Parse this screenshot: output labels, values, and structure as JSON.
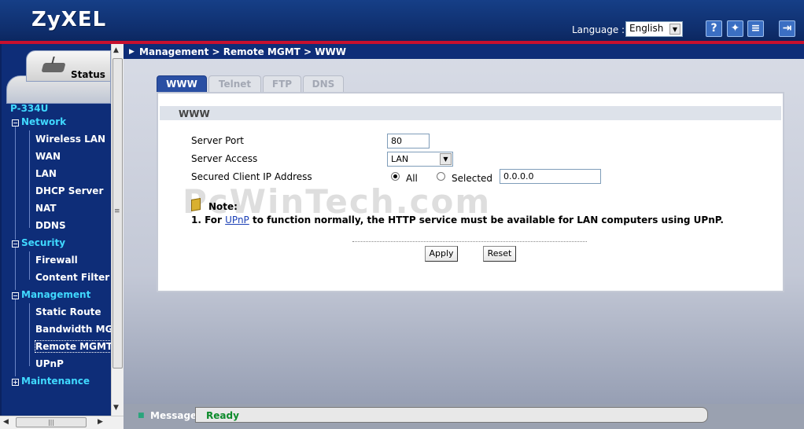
{
  "header": {
    "logo": "ZyXEL",
    "language_label": "Language :",
    "language_value": "English",
    "icons": [
      "help-icon",
      "wizard-icon",
      "notes-icon",
      "logout-icon"
    ]
  },
  "sidebar": {
    "status_tab": "Status",
    "device": "P-334U",
    "sections": [
      {
        "label": "Network",
        "items": [
          "Wireless LAN",
          "WAN",
          "LAN",
          "DHCP Server",
          "NAT",
          "DDNS"
        ]
      },
      {
        "label": "Security",
        "items": [
          "Firewall",
          "Content Filter"
        ]
      },
      {
        "label": "Management",
        "items": [
          "Static Route",
          "Bandwidth MGMT",
          "Remote MGMT",
          "UPnP"
        ]
      },
      {
        "label": "Maintenance",
        "items": []
      }
    ]
  },
  "breadcrumb": "Management > Remote MGMT > WWW",
  "tabs": [
    "WWW",
    "Telnet",
    "FTP",
    "DNS"
  ],
  "form": {
    "section_title": "WWW",
    "server_port_label": "Server Port",
    "server_port_value": "80",
    "server_access_label": "Server Access",
    "server_access_value": "LAN",
    "secured_ip_label": "Secured Client IP Address",
    "radio_all": "All",
    "radio_selected": "Selected",
    "ip_value": "0.0.0.0"
  },
  "note": {
    "title": "Note:",
    "prefix": "1. For ",
    "link": "UPnP",
    "suffix": " to function normally, the HTTP service must be available for LAN computers using UPnP."
  },
  "buttons": {
    "apply": "Apply",
    "reset": "Reset"
  },
  "watermark": "PcWinTech.com",
  "message": {
    "label": "Message",
    "status": "Ready"
  },
  "colors": {
    "header": "#163f87",
    "accent_red": "#c8102e",
    "nav_text": "#40d9ff",
    "ready_green": "#0b8a2a"
  }
}
